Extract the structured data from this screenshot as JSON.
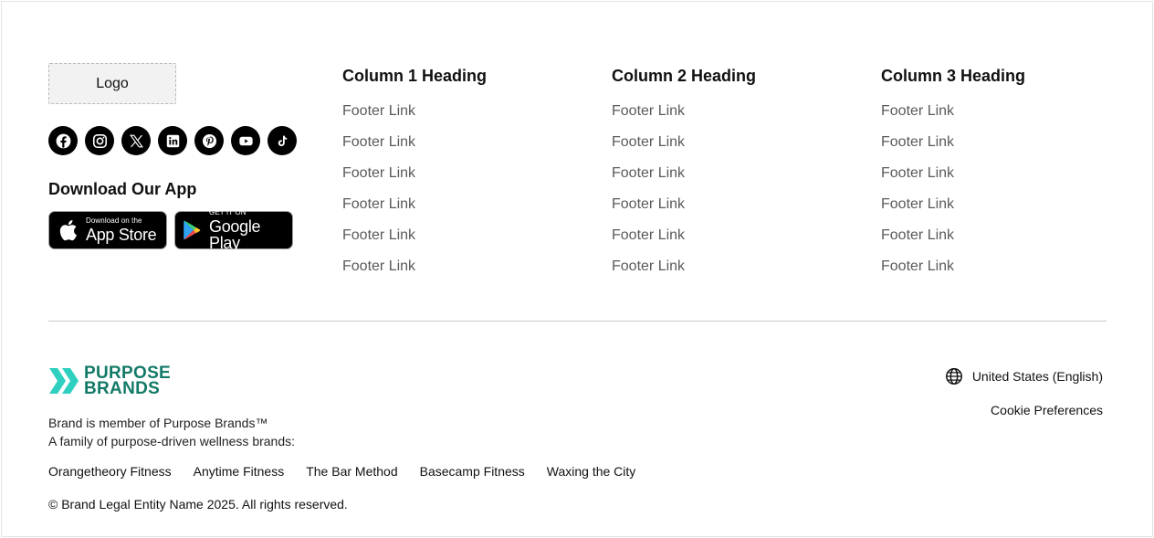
{
  "logo": {
    "label": "Logo"
  },
  "socials": [
    {
      "icon": "facebook-icon"
    },
    {
      "icon": "instagram-icon"
    },
    {
      "icon": "x-icon"
    },
    {
      "icon": "linkedin-icon"
    },
    {
      "icon": "pinterest-icon"
    },
    {
      "icon": "youtube-icon"
    },
    {
      "icon": "tiktok-icon"
    }
  ],
  "app": {
    "heading": "Download Our App",
    "apple": {
      "small": "Download on the",
      "big": "App Store"
    },
    "google": {
      "small": "GET IT ON",
      "big": "Google Play"
    }
  },
  "columns": [
    {
      "heading": "Column 1 Heading",
      "links": [
        "Footer Link",
        "Footer Link",
        "Footer Link",
        "Footer Link",
        "Footer Link",
        "Footer Link"
      ]
    },
    {
      "heading": "Column 2 Heading",
      "links": [
        "Footer Link",
        "Footer Link",
        "Footer Link",
        "Footer Link",
        "Footer Link",
        "Footer Link"
      ]
    },
    {
      "heading": "Column 3 Heading",
      "links": [
        "Footer Link",
        "Footer Link",
        "Footer Link",
        "Footer Link",
        "Footer Link",
        "Footer Link"
      ]
    }
  ],
  "parent_brand": {
    "line1": "PURPOSE",
    "line2": "BRANDS",
    "color": "#137a67",
    "accent": "#2fd0c0"
  },
  "member_text": {
    "line1": "Brand is member of Purpose Brands™",
    "line2": "A family of purpose-driven wellness brands:"
  },
  "family_brands": [
    "Orangetheory Fitness",
    "Anytime Fitness",
    "The Bar Method",
    "Basecamp Fitness",
    "Waxing the City"
  ],
  "copyright": "© Brand Legal Entity Name 2025. All rights reserved.",
  "locale": {
    "label": "United States (English)",
    "icon": "globe-icon"
  },
  "cookie": {
    "label": "Cookie Preferences"
  }
}
